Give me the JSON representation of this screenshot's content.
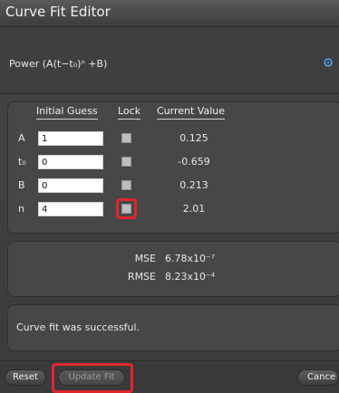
{
  "window": {
    "title": "Curve Fit Editor"
  },
  "model": {
    "label": "Power (A(t−t₀)ⁿ +B)",
    "gear_icon": "gear-icon"
  },
  "table": {
    "headers": {
      "initial_guess": "Initial Guess",
      "lock": "Lock",
      "current_value": "Current Value"
    },
    "rows": [
      {
        "param": "A",
        "guess": "1",
        "current": "0.125"
      },
      {
        "param": "t₀",
        "guess": "0",
        "current": "-0.659"
      },
      {
        "param": "B",
        "guess": "0",
        "current": "0.213"
      },
      {
        "param": "n",
        "guess": "4",
        "current": "2.01"
      }
    ]
  },
  "stats": {
    "mse_label": "MSE",
    "mse_value": "6.78x10⁻⁷",
    "rmse_label": "RMSE",
    "rmse_value": "8.23x10⁻⁴"
  },
  "status": {
    "message": "Curve fit was successful."
  },
  "buttons": {
    "reset": "Reset",
    "update_fit": "Update Fit",
    "cancel": "Cance"
  },
  "colors": {
    "highlight": "#e0262c",
    "accent": "#4fa3ff"
  }
}
